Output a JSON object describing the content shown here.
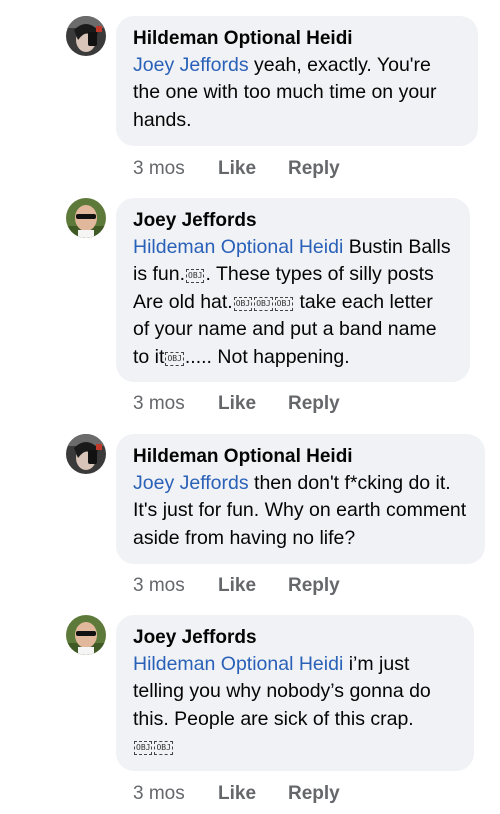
{
  "comments": [
    {
      "author": "Hildeman Optional Heidi",
      "avatar": "woman-phone-photo",
      "mention": "Joey Jeffords",
      "text_parts": [
        " yeah, exactly. You're the one with too much time on your hands."
      ],
      "time": "3 mos",
      "like": "Like",
      "reply": "Reply"
    },
    {
      "author": "Joey Jeffords",
      "avatar": "man-sunglasses-photo",
      "mention": "Hildeman Optional Heidi",
      "text_parts": [
        " Bustin Balls is fun.",
        ". These types of silly posts Are old hat.",
        " take each letter of your name and put a band name  to it",
        ".....   Not happening."
      ],
      "time": "3 mos",
      "like": "Like",
      "reply": "Reply"
    },
    {
      "author": "Hildeman Optional Heidi",
      "avatar": "woman-phone-photo",
      "mention": "Joey Jeffords",
      "text_parts": [
        " then don't f*cking do it. It's just for fun. Why on earth comment aside from having no life?"
      ],
      "time": "3 mos",
      "like": "Like",
      "reply": "Reply"
    },
    {
      "author": "Joey Jeffords",
      "avatar": "man-sunglasses-photo",
      "mention": "Hildeman Optional Heidi",
      "text_parts": [
        "  i’m just telling you why nobody’s gonna do this. People are sick of this crap."
      ],
      "time": "3 mos",
      "like": "Like",
      "reply": "Reply"
    }
  ],
  "obj_glyph": "OBJ"
}
